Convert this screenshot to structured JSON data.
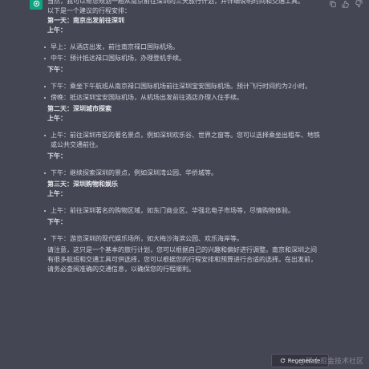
{
  "message": {
    "intro_line1": "当然，我可以帮您规划一趟从南京前往深圳的三天旅行计划，并详细说明时间和交通工具。",
    "intro_line2": "以下是一个建议的行程安排：",
    "days": [
      {
        "title": "第一天：南京出发前往深圳",
        "periods": [
          {
            "label": "上午：",
            "items": [
              "早上：从酒店出发，前往南京禄口国际机场。",
              "中午：预计抵达禄口国际机场，办理登机手续。"
            ]
          },
          {
            "label": "下午：",
            "items": [
              "下午：乘坐下午航班从南京禄口国际机场前往深圳宝安国际机场。预计飞行时间约为2小时。",
              "傍晚：抵达深圳宝安国际机场，从机场出发前往酒店办理入住手续。"
            ]
          }
        ]
      },
      {
        "title": "第二天：深圳城市探索",
        "periods": [
          {
            "label": "上午：",
            "items": [
              "上午：前往深圳市区的著名景点，例如深圳欢乐谷、世界之窗等。您可以选择乘坐出租车、地铁或公共交通前往。"
            ]
          },
          {
            "label": "下午：",
            "items": [
              "下午：继续探索深圳的景点，例如深圳湾公园、华侨城等。"
            ]
          }
        ]
      },
      {
        "title": "第三天：深圳购物和娱乐",
        "periods": [
          {
            "label": "上午：",
            "items": [
              "上午：前往深圳著名的购物区域，如东门商业区、华强北电子市场等，尽情购物体验。"
            ]
          },
          {
            "label": "下午：",
            "items": [
              "下午：游览深圳的现代娱乐场所，如大梅沙海滨公园、欢乐海岸等。"
            ]
          }
        ]
      }
    ],
    "closing": "请注意，这只是一个基本的旅行计划，您可以根据自己的兴趣和偏好进行调整。南京和深圳之间有很多航班和交通工具可供选择，您可以根据您的行程安排和预算进行合适的选择。在出发前，请务必查阅准确的交通信息，以确保您的行程顺利。"
  },
  "regenerate_label": "Regenerate",
  "watermark": "@稀土掘金技术社区",
  "colors": {
    "background": "#444654",
    "text": "#d1d5db",
    "accent": "#10a37f"
  },
  "icons": [
    "openai-logo-icon",
    "copy-icon",
    "thumbs-up-icon",
    "thumbs-down-icon",
    "refresh-icon"
  ]
}
